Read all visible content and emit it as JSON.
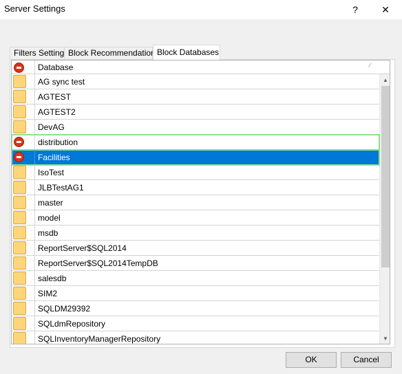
{
  "window": {
    "title": "Server Settings",
    "help_label": "?",
    "close_label": "✕"
  },
  "tabs": [
    {
      "label": "Filters Settings",
      "active": false
    },
    {
      "label": "Block Recommendations",
      "active": false
    },
    {
      "label": "Block Databases",
      "active": true
    }
  ],
  "grid": {
    "column_header": "Database",
    "header_icon": "block-icon",
    "sort_glyph": "⁄",
    "rows": [
      {
        "name": "AG sync test",
        "icon": "folder-icon",
        "state": "normal"
      },
      {
        "name": "AGTEST",
        "icon": "folder-icon",
        "state": "normal"
      },
      {
        "name": "AGTEST2",
        "icon": "folder-icon",
        "state": "normal"
      },
      {
        "name": "DevAG",
        "icon": "folder-icon",
        "state": "normal"
      },
      {
        "name": "distribution",
        "icon": "block-icon",
        "state": "highlighted"
      },
      {
        "name": "Facilities",
        "icon": "block-icon",
        "state": "selected"
      },
      {
        "name": "IsoTest",
        "icon": "folder-icon",
        "state": "normal"
      },
      {
        "name": "JLBTestAG1",
        "icon": "folder-icon",
        "state": "normal"
      },
      {
        "name": "master",
        "icon": "folder-icon",
        "state": "normal"
      },
      {
        "name": "model",
        "icon": "folder-icon",
        "state": "normal"
      },
      {
        "name": "msdb",
        "icon": "folder-icon",
        "state": "normal"
      },
      {
        "name": "ReportServer$SQL2014",
        "icon": "folder-icon",
        "state": "normal"
      },
      {
        "name": "ReportServer$SQL2014TempDB",
        "icon": "folder-icon",
        "state": "normal"
      },
      {
        "name": "salesdb",
        "icon": "folder-icon",
        "state": "normal"
      },
      {
        "name": "SIM2",
        "icon": "folder-icon",
        "state": "normal"
      },
      {
        "name": "SQLDM29392",
        "icon": "folder-icon",
        "state": "normal"
      },
      {
        "name": "SQLdmRepository",
        "icon": "folder-icon",
        "state": "normal"
      },
      {
        "name": "SQLInventoryManagerRepository",
        "icon": "folder-icon",
        "state": "normal"
      }
    ]
  },
  "scrollbar": {
    "up_glyph": "▲",
    "down_glyph": "▼",
    "scroll_fraction": 0.0
  },
  "buttons": {
    "ok_label": "OK",
    "cancel_label": "Cancel"
  },
  "colors": {
    "selection": "#0078d7",
    "highlight_outline": "#8fe08f",
    "folder": "#ffd57a",
    "block": "#d9331a"
  }
}
